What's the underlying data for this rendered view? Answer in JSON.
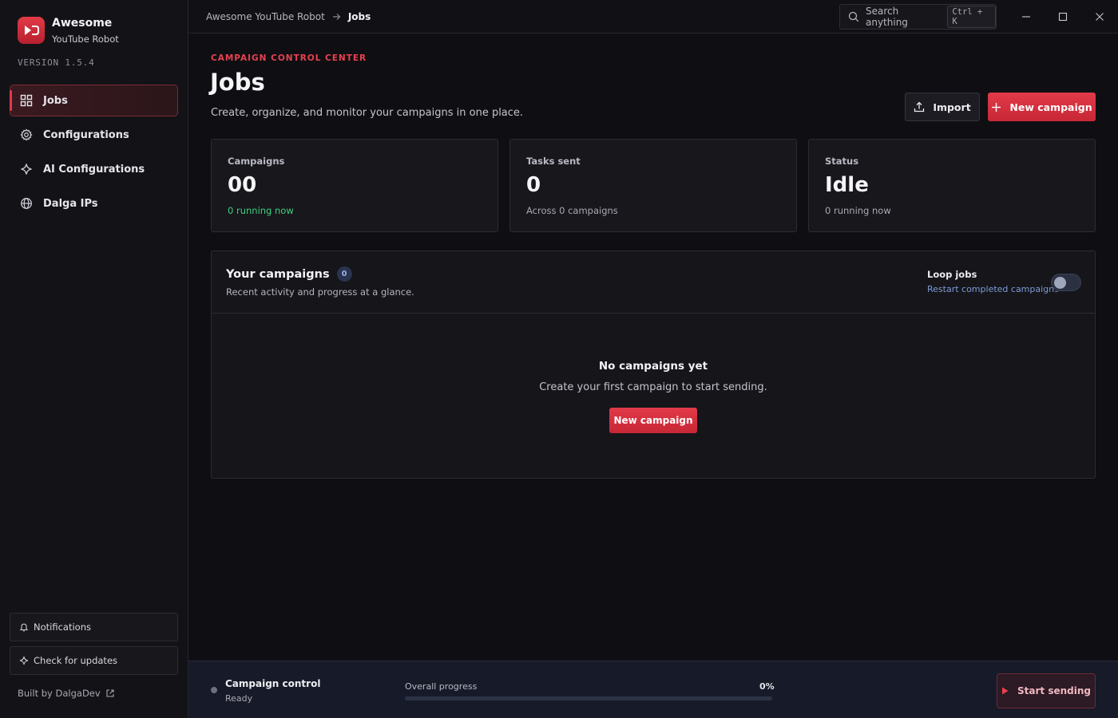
{
  "app": {
    "name": "Awesome",
    "subname": "YouTube Robot",
    "version": "VERSION 1.5.4",
    "accent": "#e23a48"
  },
  "sidebar": {
    "items": [
      {
        "label": "Jobs",
        "icon": "grid-icon",
        "active": true
      },
      {
        "label": "Configurations",
        "icon": "gear-icon",
        "active": false
      },
      {
        "label": "AI Configurations",
        "icon": "sparkle-icon",
        "active": false
      },
      {
        "label": "Dalga IPs",
        "icon": "globe-icon",
        "active": false
      }
    ],
    "notifications_label": "Notifications",
    "updates_label": "Check for updates",
    "built_by": "Built by DalgaDev"
  },
  "topbar": {
    "breadcrumb_root": "Awesome YouTube Robot",
    "breadcrumb_current": "Jobs",
    "search_placeholder": "Search anything",
    "search_shortcut": "Ctrl + K"
  },
  "header": {
    "eyebrow": "CAMPAIGN CONTROL CENTER",
    "title": "Jobs",
    "subtitle": "Create, organize, and monitor your campaigns in one place.",
    "import_label": "Import",
    "new_campaign_label": "New campaign"
  },
  "stats": [
    {
      "label": "Campaigns",
      "value": "00",
      "note": "0 running now"
    },
    {
      "label": "Tasks sent",
      "value": "0",
      "note": "Across 0 campaigns"
    },
    {
      "label": "Status",
      "value": "Idle",
      "note": "0 running now"
    }
  ],
  "campaigns": {
    "title": "Your campaigns",
    "count": "0",
    "subtitle": "Recent activity and progress at a glance.",
    "loop_title": "Loop jobs",
    "loop_subtitle": "Restart completed campaigns",
    "loop_enabled": false,
    "empty_title": "No campaigns yet",
    "empty_subtitle": "Create your first campaign to start sending.",
    "empty_button": "New campaign"
  },
  "footer": {
    "control_title": "Campaign control",
    "control_status": "Ready",
    "progress_label": "Overall progress",
    "progress_text": "0%",
    "progress_value": 0,
    "start_label": "Start sending"
  }
}
